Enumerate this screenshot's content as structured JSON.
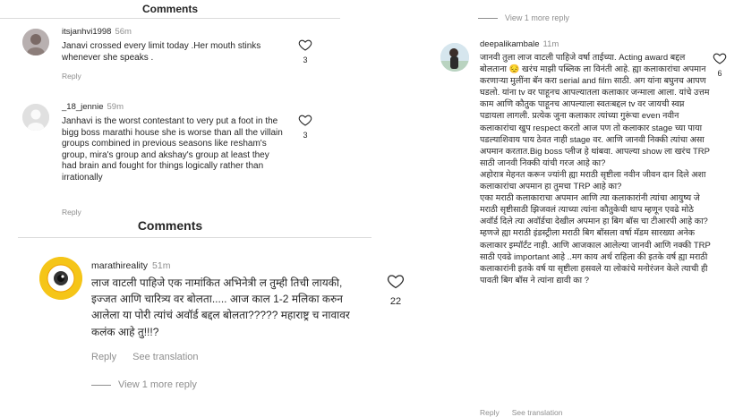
{
  "left_panel": {
    "header_top": "Comments",
    "header_mid": "Comments",
    "comments": [
      {
        "username": "itsjanhvi1998",
        "time": "56m",
        "text": "Janavi crossed every limit today .Her mouth stinks whenever she speaks .",
        "likes": "3",
        "reply_label": "Reply"
      },
      {
        "username": "_18_jennie",
        "time": "59m",
        "text": "Janhavi is the worst contestant to very put a foot in the bigg boss marathi house she is worse than all the villain groups combined in previous seasons like resham's group, mira's group and akshay's group at least they had brain and fought for things logically rather than irrationally",
        "likes": "3",
        "reply_label": "Reply"
      }
    ],
    "main_comment": {
      "username": "marathireality",
      "time": "51m",
      "text": "लाज वाटली पाहिजे एक नामांकित अभिनेत्री ल तुम्ही तिची लायकी, इज्जत आणि चारित्र्य वर बोलता..... आज काल 1-2 मलिका करुन आलेला या पोरी त्यांचं अवॉर्ड बद्दल बोलता????? महाराष्ट्र च नावावर कलंक आहे तु!!!?",
      "likes": "22",
      "reply_label": "Reply",
      "see_translation_label": "See translation",
      "view_more_label": "View 1 more reply"
    }
  },
  "right_panel": {
    "view_more_label": "View 1 more reply",
    "comment": {
      "username": "deepalikambale",
      "time": "11m",
      "text": "जानवी तुला लाज वाटली पाहिजे वर्षा ताईच्या. Acting award  बद्दल बोलताना 😔 खरंच माझी पब्लिक ला विनंती आहे. ह्या कलाकारांचा अपमान करणाऱ्या मुलींना बॅन करा serial and film साठी. अग यांना बघुनच आपण घडलो. यांना tv वर पाहूनच आपल्यातला कलाकार जन्माला आला. यांचे उत्तम काम आणि कौतुक पाहूनच  आपल्याला स्वतःबद्दल tv वर जायची स्वप्न पडायला लागली. प्रत्येक जुना कलाकार त्यांच्या गुरूंचा even नवीन कलाकारांचा खुप respect करतो आज पण तो कलाकार stage च्या पाया पडल्याशिवाय पाय ठेवत नाही stage वर. आणि जानवी निक्की त्यांचा असा अपमान करतात.Big boss प्लीज हे थांबवा. आपल्या show ला खरंच TRP साठी जानवी निक्की यांची गरज आहे का?\nअहोरात्र मेहनत करून ज्यांनी ह्या मराठी सृष्टीला नवीन जीवन दान दिले अशा  कलाकारांचा अपमान हा तुमचा TRP आहे का?\nएका मराठी कलाकाराचा अपमान आणि त्या कलाकारांनी त्यांचा  आयुष्य जे मराठी सृष्टीसाठी झिजवलं त्याच्या त्यांना कौतुकेची थाप म्हणून एवढे मोठे अवॉर्ड दिले त्या अवॉर्डचा देखील अपमान हा बिग बॉस चा टीआरपी आहे का?\n म्हणजे ह्या मराठी इंडस्ट्रीला मराठी बिग बॉसला वर्षा मॅडम सारख्या अनेक कलाकार इम्पॉर्टंट नाही. आणि आजकाल आलेल्या जानवी आणि नक्की TRP साठी एवढे important आहे ..मग काय अर्थ राहिला की इतके वर्ष ह्या मराठी कलाकारांनी इतके वर्ष या सृष्टीला हसवले या लोकांचे मनोरंजन केले त्याची ही पावती बिग बॉस ने त्यांना द्यावी का ?",
      "likes": "6",
      "reply_label": "Reply",
      "see_translation_label": "See translation"
    }
  },
  "colors": {
    "text": "#262626",
    "muted": "#8e8e8e",
    "divider": "#dbdbdb",
    "badge_yellow": "#f5c518"
  }
}
